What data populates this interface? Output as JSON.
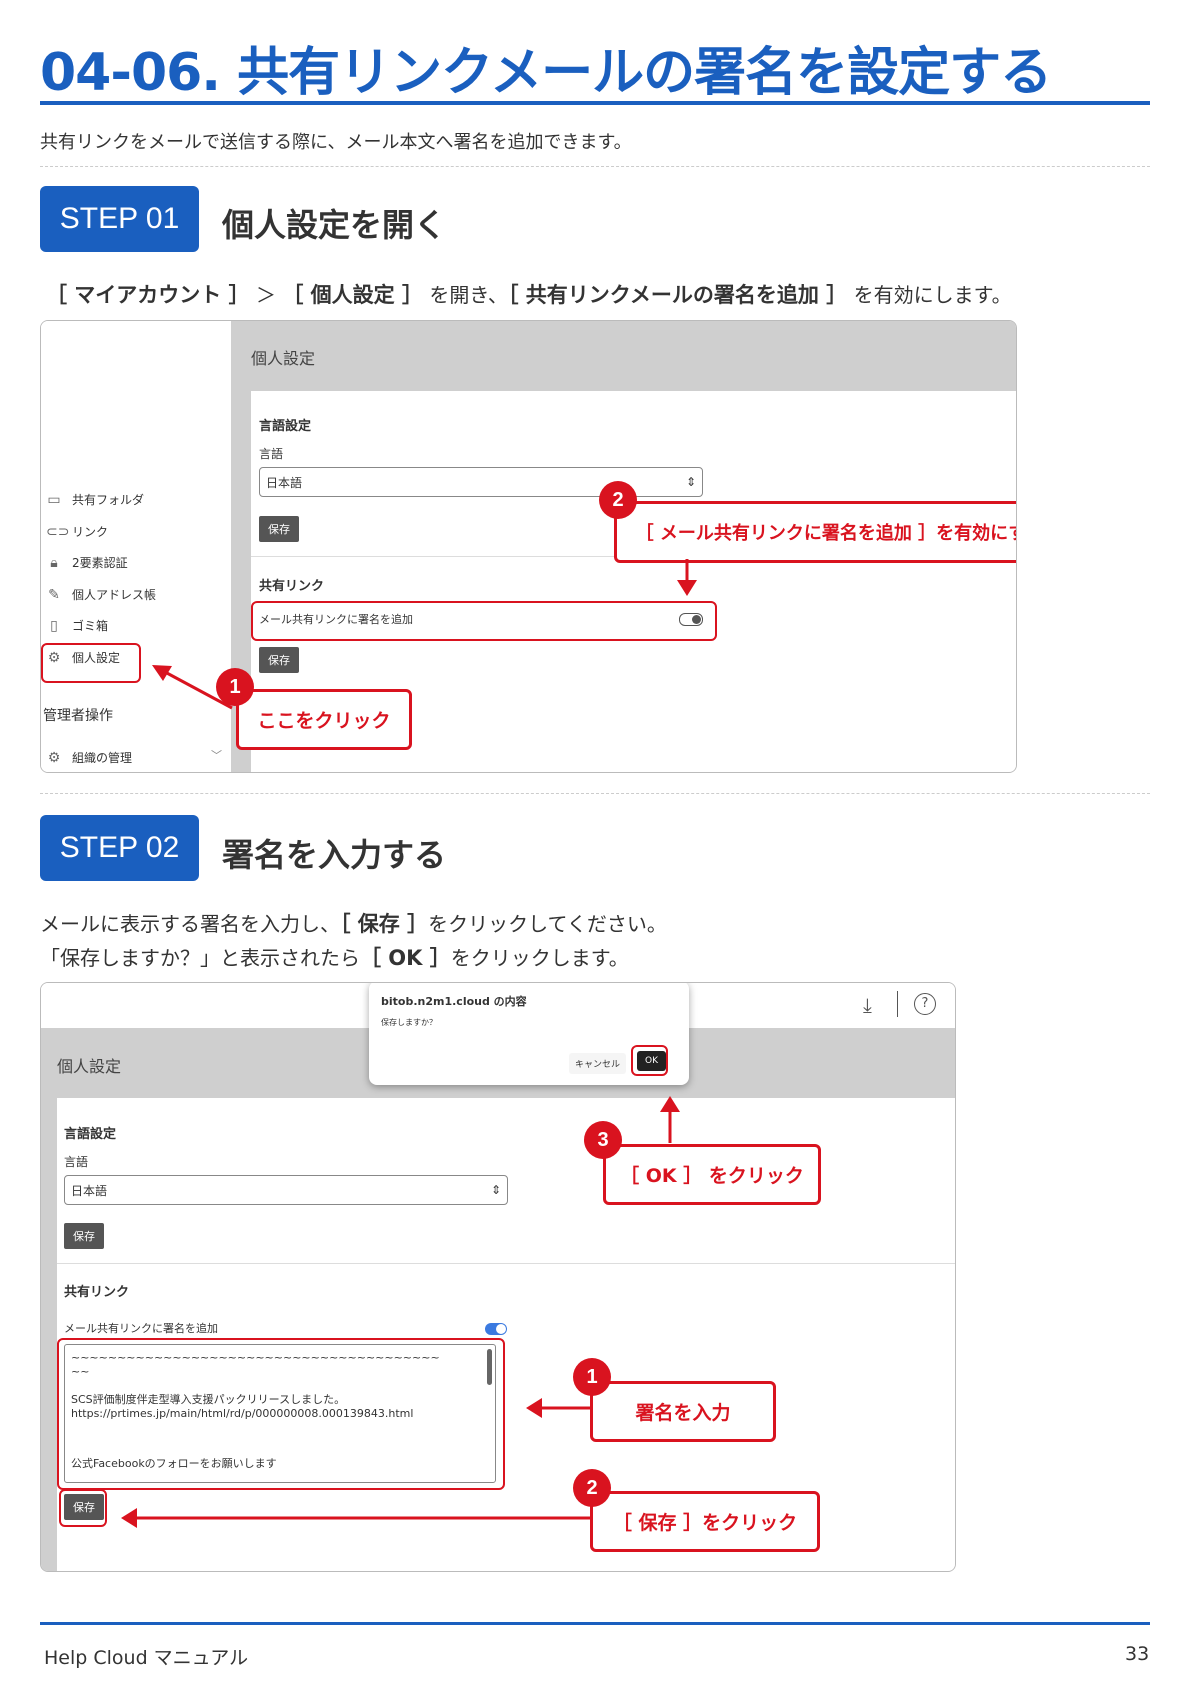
{
  "header": {
    "title": "04-06. 共有リンクメールの署名を設定する",
    "intro": "共有リンクをメールで送信する際に、メール本文へ署名を追加できます。"
  },
  "step1": {
    "badge": "STEP 01",
    "title": "個人設定を開く",
    "desc_parts": [
      "［ マイアカウント ］",
      " ＞ ",
      "［ 個人設定 ］",
      " を開き、",
      "［ 共有リンクメールの署名を追加 ］",
      " を有効にします。"
    ],
    "screen": {
      "panel_title": "個人設定",
      "lang_heading": "言語設定",
      "lang_label": "言語",
      "lang_value": "日本語",
      "save": "保存",
      "share_heading": "共有リンク",
      "toggle_label": "メール共有リンクに署名を追加",
      "sidebar": [
        {
          "icon": "folder-icon",
          "label": "共有フォルダ"
        },
        {
          "icon": "link-icon",
          "label": "リンク"
        },
        {
          "icon": "lock-icon",
          "label": "2要素認証"
        },
        {
          "icon": "edit-icon",
          "label": "個人アドレス帳"
        },
        {
          "icon": "trash-icon",
          "label": "ゴミ箱"
        },
        {
          "icon": "gear-icon",
          "label": "個人設定"
        }
      ],
      "admin_heading": "管理者操作",
      "admin_item": "組織の管理"
    },
    "callouts": {
      "c1_num": "1",
      "c1_text": "ここをクリック",
      "c2_num": "2",
      "c2_text": "［ メール共有リンクに署名を追加 ］を有効にする"
    }
  },
  "step2": {
    "badge": "STEP 02",
    "title": "署名を入力する",
    "desc_line1_parts": [
      "メールに表示する署名を入力し、",
      "［ 保存 ］",
      "をクリックしてください。"
    ],
    "desc_line2_parts": [
      "「保存しますか？」と表示されたら",
      "［ OK ］",
      "をクリックします。"
    ],
    "screen": {
      "dialog_title": "bitob.n2m1.cloud の内容",
      "dialog_msg": "保存しますか？",
      "dialog_cancel": "キャンセル",
      "dialog_ok": "OK",
      "panel_title": "個人設定",
      "lang_heading": "言語設定",
      "lang_label": "言語",
      "lang_value": "日本語",
      "save": "保存",
      "share_heading": "共有リンク",
      "toggle_label": "メール共有リンクに署名を追加",
      "sig_line1": "~~~~~~~~~~~~~~~~~~~~~~~~~~~~~~~~~~~~~~~~",
      "sig_line2": "~~",
      "sig_line3": "SCS評価制度伴走型導入支援パックリリースしました。",
      "sig_line4": "https://prtimes.jp/main/html/rd/p/000000008.000139843.html",
      "sig_line5": "公式Facebookのフォローをお願いします"
    },
    "callouts": {
      "c1_num": "1",
      "c1_text": "署名を入力",
      "c2_num": "2",
      "c2_text": "［ 保存 ］をクリック",
      "c3_num": "3",
      "c3_text": "［ OK ］ をクリック"
    }
  },
  "footer": {
    "left": "Help Cloud マニュアル",
    "page": "33"
  },
  "colors": {
    "brand": "#1a5fbf",
    "accent": "#d9131f"
  }
}
